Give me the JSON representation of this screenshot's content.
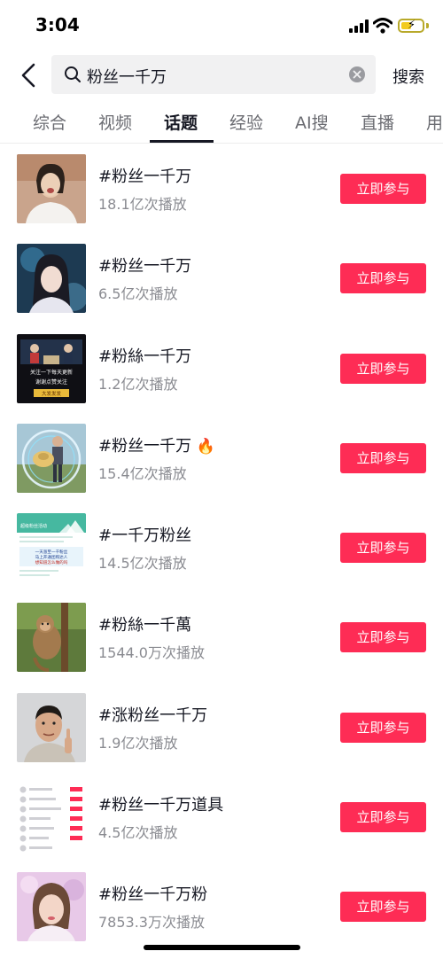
{
  "status_bar": {
    "time": "3:04",
    "battery_color": "#f2cb1f"
  },
  "search": {
    "query": "粉丝一千万",
    "submit_label": "搜索"
  },
  "tabs": [
    {
      "label": "综合",
      "active": false
    },
    {
      "label": "视频",
      "active": false
    },
    {
      "label": "话题",
      "active": true
    },
    {
      "label": "经验",
      "active": false
    },
    {
      "label": "AI搜",
      "active": false
    },
    {
      "label": "直播",
      "active": false
    },
    {
      "label": "用",
      "active": false
    }
  ],
  "accent_color": "#fe2c55",
  "topics": [
    {
      "title": "#粉丝一千万",
      "plays": "18.1亿次播放",
      "button": "立即参与"
    },
    {
      "title": "#粉丝一千万",
      "plays": "6.5亿次播放",
      "button": "立即参与"
    },
    {
      "title": "#粉絲一千万",
      "plays": "1.2亿次播放",
      "button": "立即参与",
      "thumb_text": {
        "line1": "关注一下每天更新",
        "line2": "谢谢点赞关注",
        "line3": "大发发发"
      }
    },
    {
      "title": "#粉丝一千万",
      "title_icon": "fire-emoji",
      "fire": "🔥",
      "plays": "15.4亿次播放",
      "button": "立即参与"
    },
    {
      "title": "#一千万粉丝",
      "plays": "14.5亿次播放",
      "button": "立即参与",
      "thumb_text": {
        "line1": "超级粉丝活动",
        "line2": "一天涨至一千粉丝",
        "line3": "马上开通团购达人",
        "line4": "想知道怎么做的吗"
      }
    },
    {
      "title": "#粉絲一千萬",
      "plays": "1544.0万次播放",
      "button": "立即参与"
    },
    {
      "title": "#涨粉丝一千万",
      "plays": "1.9亿次播放",
      "button": "立即参与"
    },
    {
      "title": "#粉丝一千万道具",
      "plays": "4.5亿次播放",
      "button": "立即参与"
    },
    {
      "title": "#粉丝一千万粉",
      "plays": "7853.3万次播放",
      "button": "立即参与"
    }
  ]
}
